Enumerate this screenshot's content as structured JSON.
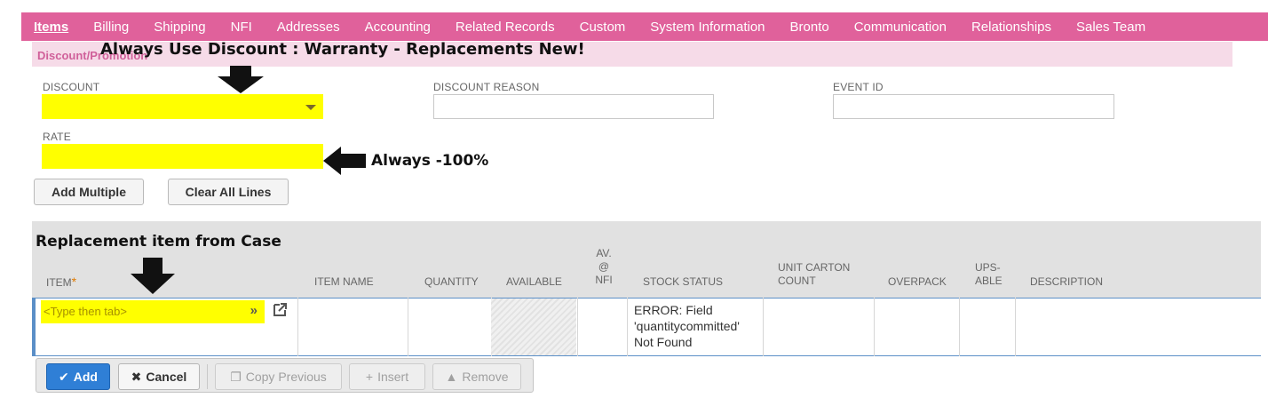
{
  "tabs": [
    {
      "label": "Items",
      "active": true
    },
    {
      "label": "Billing"
    },
    {
      "label": "Shipping"
    },
    {
      "label": "NFI"
    },
    {
      "label": "Addresses"
    },
    {
      "label": "Accounting"
    },
    {
      "label": "Related Records"
    },
    {
      "label": "Custom"
    },
    {
      "label": "System Information"
    },
    {
      "label": "Bronto"
    },
    {
      "label": "Communication"
    },
    {
      "label": "Relationships"
    },
    {
      "label": "Sales Team"
    }
  ],
  "section": {
    "title": "Discount/Promotion",
    "annotation": "Always Use Discount : Warranty - Replacements New!"
  },
  "fields": {
    "discount_label": "DISCOUNT",
    "discount_reason_label": "DISCOUNT REASON",
    "event_id_label": "EVENT ID",
    "rate_label": "RATE",
    "rate_annotation": "Always -100%"
  },
  "buttons": {
    "add_multiple": "Add Multiple",
    "clear_all_lines": "Clear All Lines"
  },
  "grid": {
    "annotation": "Replacement item from Case",
    "columns": {
      "item": "ITEM",
      "item_name": "ITEM NAME",
      "quantity": "QUANTITY",
      "available": "AVAILABLE",
      "av_nfi_1": "AV.",
      "av_nfi_2": "@",
      "av_nfi_3": "NFI",
      "stock_status": "STOCK STATUS",
      "unit_carton_1": "UNIT CARTON",
      "unit_carton_2": "COUNT",
      "overpack": "OVERPACK",
      "upsable_1": "UPS-",
      "upsable_2": "ABLE",
      "description": "DESCRIPTION"
    },
    "required_marker": "*",
    "row": {
      "item_placeholder": "<Type then tab>",
      "stock_status_lines": [
        "ERROR: Field",
        "'quantitycommitted'",
        "Not Found"
      ]
    }
  },
  "actions": {
    "add": "Add",
    "cancel": "Cancel",
    "copy_previous": "Copy Previous",
    "insert": "Insert",
    "remove": "Remove"
  },
  "colors": {
    "tab_bar": "#e0619b",
    "section_bg": "#f6dbe8",
    "highlight": "#ffff00",
    "primary": "#2f7fd6"
  }
}
